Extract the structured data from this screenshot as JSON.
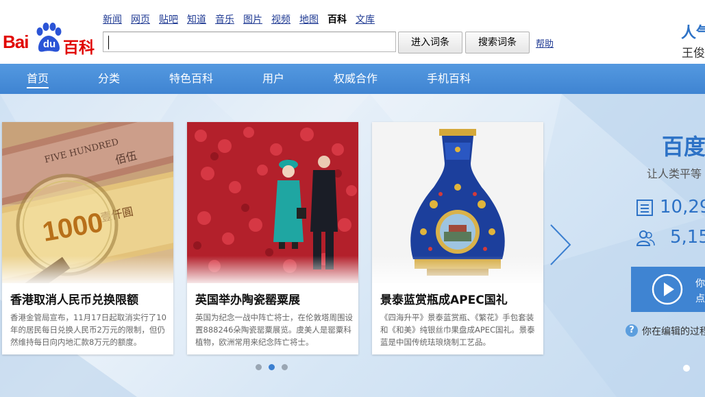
{
  "header": {
    "logo": {
      "bai": "Bai",
      "du": "du",
      "baike": "百科"
    },
    "topnav": [
      {
        "label": "新闻",
        "active": false
      },
      {
        "label": "网页",
        "active": false
      },
      {
        "label": "贴吧",
        "active": false
      },
      {
        "label": "知道",
        "active": false
      },
      {
        "label": "音乐",
        "active": false
      },
      {
        "label": "图片",
        "active": false
      },
      {
        "label": "视频",
        "active": false
      },
      {
        "label": "地图",
        "active": false
      },
      {
        "label": "百科",
        "active": true
      },
      {
        "label": "文库",
        "active": false
      }
    ],
    "search": {
      "value": "",
      "placeholder": ""
    },
    "enter_button": "进入词条",
    "search_button": "搜索词条",
    "help_link": "帮助",
    "promo_big": "人气",
    "promo_small": "王俊"
  },
  "mainnav": {
    "items": [
      {
        "label": "首页",
        "active": true
      },
      {
        "label": "分类",
        "active": false
      },
      {
        "label": "特色百科",
        "active": false
      },
      {
        "label": "用户",
        "active": false
      },
      {
        "label": "权威合作",
        "active": false
      },
      {
        "label": "手机百科",
        "active": false
      }
    ]
  },
  "carousel": {
    "cards": [
      {
        "title": "香港取消人民币兑换限额",
        "desc": "香港金管局宣布，11月17日起取消实行了10年的居民每日兑换人民币2万元的限制，但仍然维持每日向内地汇款8万元的额度。",
        "banknote_text": "1000",
        "banknote_text2": "佰伍",
        "banknote_text3": "FIVE HUNDRED",
        "banknote_text4": "壹仟圓"
      },
      {
        "title": "英国举办陶瓷罂粟展",
        "desc": "英国为纪念一战中阵亡将士，在伦敦塔周围设置888246朵陶瓷罂粟展览。虞美人是罂粟科植物，欧洲常用来纪念阵亡将士。"
      },
      {
        "title": "景泰蓝赏瓶成APEC国礼",
        "desc": "《四海升平》景泰蓝赏瓶、《繁花》手包套装和《和美》纯银丝巾果盘成APEC国礼。景泰蓝是中国传统珐琅烧制工艺品。"
      }
    ],
    "active_dot": 1,
    "dot_count": 3
  },
  "sidebar": {
    "title": "百度",
    "slogan": "让人类平等",
    "stat_entries": "10,29",
    "stat_users": "5,15",
    "play_line1": "你",
    "play_line2": "点",
    "question_text": "你在编辑的过程"
  },
  "colors": {
    "brand_red": "#e10602",
    "brand_blue": "#2d72c6",
    "nav_blue": "#4a8fd9",
    "link_blue": "#1f3a93"
  }
}
